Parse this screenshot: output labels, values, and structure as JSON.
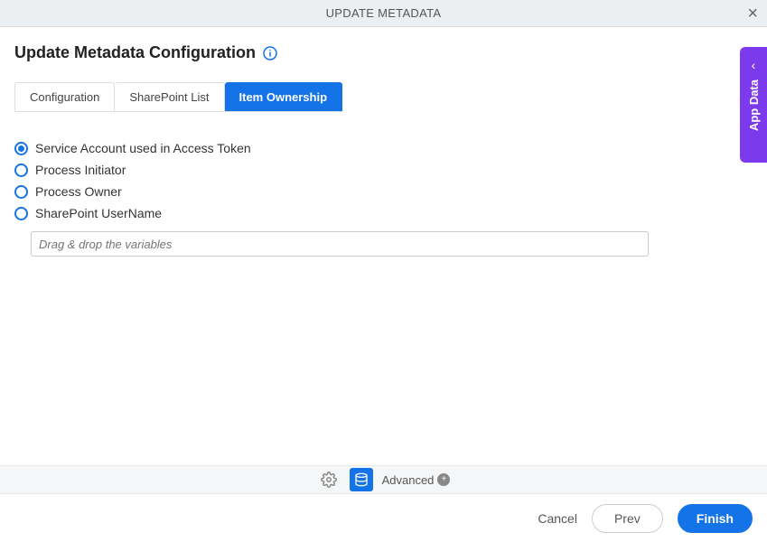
{
  "header": {
    "title": "UPDATE METADATA"
  },
  "page": {
    "title": "Update Metadata Configuration"
  },
  "tabs": [
    {
      "label": "Configuration",
      "active": false
    },
    {
      "label": "SharePoint List",
      "active": false
    },
    {
      "label": "Item Ownership",
      "active": true
    }
  ],
  "options": {
    "o0": "Service Account used in Access Token",
    "o1": "Process Initiator",
    "o2": "Process Owner",
    "o3": "SharePoint UserName",
    "variable_placeholder": "Drag & drop the variables"
  },
  "toolbar": {
    "advanced_label": "Advanced"
  },
  "footer": {
    "cancel": "Cancel",
    "prev": "Prev",
    "finish": "Finish"
  },
  "side_panel": {
    "label": "App Data"
  }
}
